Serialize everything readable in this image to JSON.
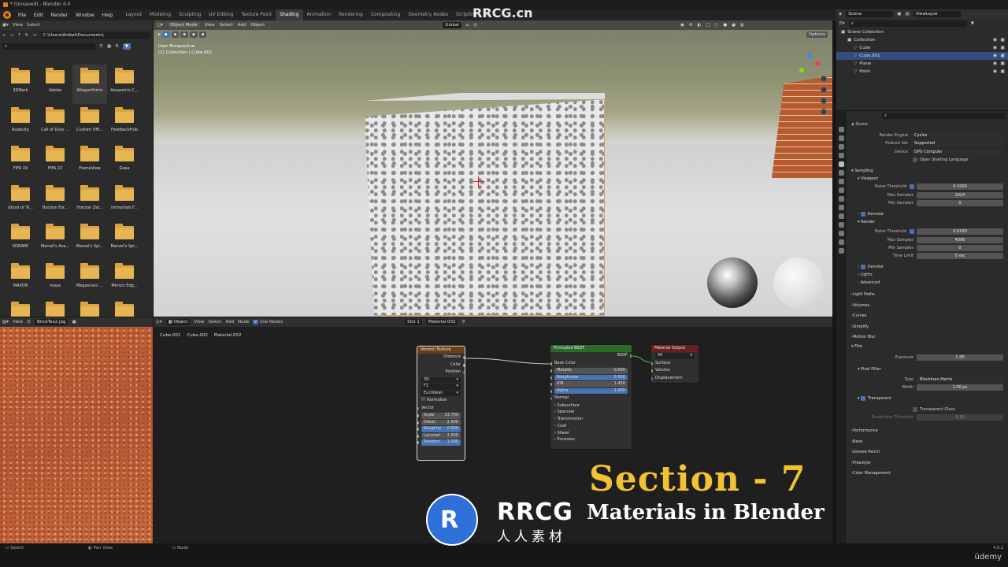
{
  "window": {
    "title": "* (Unsaved) - Blender 4.0"
  },
  "menu": [
    "File",
    "Edit",
    "Render",
    "Window",
    "Help"
  ],
  "workspaces": [
    {
      "label": "Layout",
      "active": false
    },
    {
      "label": "Modeling",
      "active": false
    },
    {
      "label": "Sculpting",
      "active": false
    },
    {
      "label": "UV Editing",
      "active": false
    },
    {
      "label": "Texture Paint",
      "active": false
    },
    {
      "label": "Shading",
      "active": true
    },
    {
      "label": "Animation",
      "active": false
    },
    {
      "label": "Rendering",
      "active": false
    },
    {
      "label": "Compositing",
      "active": false
    },
    {
      "label": "Geometry Nodes",
      "active": false
    },
    {
      "label": "Scripting",
      "active": false
    }
  ],
  "add_workspace": "+",
  "file_browser": {
    "menu": [
      "View",
      "Select"
    ],
    "path": "C:\\Users\\Aniket\\Documents\\",
    "folders": [
      "3DMark",
      "Adobe",
      "Allegorithmic",
      "Assassin's C...",
      "Audacity",
      "Call of Duty ...",
      "Custom Offi...",
      "FeedbackHub",
      "FIFA 19",
      "FIFA 22",
      "FrameView",
      "Gaea",
      "Ghost of Ts...",
      "Horizon For...",
      "Horizon Zer...",
      "Immortals F...",
      "KONAMI",
      "Marvel's Ave...",
      "Marvel's Spi...",
      "Marvel's Spi...",
      "MAXON",
      "maya",
      "Megascans ...",
      "Mirrors Edg...",
      "",
      "",
      "",
      ""
    ],
    "selected_index": 2
  },
  "viewport": {
    "mode": "Object Mode",
    "menu": [
      "View",
      "Select",
      "Add",
      "Object"
    ],
    "orientation": "Global",
    "options": "Options",
    "info_line1": "User Perspective",
    "info_line2": "(1) Collection | Cube.001"
  },
  "image_editor": {
    "view": "View",
    "image_name": "BrickTex2.jpg"
  },
  "node_editor": {
    "mode": "Object",
    "menu": [
      "View",
      "Select",
      "Add",
      "Node"
    ],
    "use_nodes": "Use Nodes",
    "slot": "Slot 1",
    "material": "Material.002",
    "breadcrumb": [
      "Cube.001",
      "Cube.002",
      "Material.002"
    ],
    "voronoi": {
      "title": "Voronoi Texture",
      "outputs": [
        "Distance",
        "Color",
        "Position"
      ],
      "dims": "3D",
      "feature": "F1",
      "metric": "Euclidean",
      "normalize": "Normalize",
      "vector": "Vector",
      "fields": [
        {
          "label": "Scale",
          "value": "13.700"
        },
        {
          "label": "Detail",
          "value": "2.500"
        },
        {
          "label": "Roughne",
          "value": "0.500"
        },
        {
          "label": "Lacunari",
          "value": "2.000"
        },
        {
          "label": "Random",
          "value": "1.000"
        }
      ]
    },
    "bsdf": {
      "title": "Principled BSDF",
      "output": "BSDF",
      "base_color": "Base Color",
      "fields": [
        {
          "label": "Metallic",
          "value": "0.000"
        },
        {
          "label": "Roughness",
          "value": "0.500"
        },
        {
          "label": "IOR",
          "value": "1.450"
        },
        {
          "label": "Alpha",
          "value": "1.000"
        }
      ],
      "normal": "Normal",
      "panels": [
        "Subsurface",
        "Specular",
        "Transmission",
        "Coat",
        "Sheen",
        "Emission"
      ]
    },
    "output": {
      "title": "Material Output",
      "target": "All",
      "inputs": [
        "Surface",
        "Volume",
        "Displacement"
      ]
    }
  },
  "outliner": {
    "scene": "Scene",
    "view_layer": "ViewLayer",
    "items": [
      {
        "label": "Scene Collection",
        "indent": 0,
        "sel": false
      },
      {
        "label": "Collection",
        "indent": 1,
        "sel": false
      },
      {
        "label": "Cube",
        "indent": 2,
        "sel": false
      },
      {
        "label": "Cube.001",
        "indent": 2,
        "sel": true
      },
      {
        "label": "Plane",
        "indent": 2,
        "sel": false
      },
      {
        "label": "Point",
        "indent": 2,
        "sel": false
      }
    ]
  },
  "properties": {
    "context": "Scene",
    "render_engine": {
      "label": "Render Engine",
      "value": "Cycles"
    },
    "feature_set": {
      "label": "Feature Set",
      "value": "Supported"
    },
    "device": {
      "label": "Device",
      "value": "GPU Compute"
    },
    "osl": "Open Shading Language",
    "sampling": "Sampling",
    "viewport": "Viewport",
    "vp_noise": {
      "label": "Noise Threshold",
      "value": "0.1000"
    },
    "vp_max": {
      "label": "Max Samples",
      "value": "1024"
    },
    "vp_min": {
      "label": "Min Samples",
      "value": "0"
    },
    "denoise": "Denoise",
    "render": "Render",
    "r_noise": {
      "label": "Noise Threshold",
      "value": "0.0100"
    },
    "r_max": {
      "label": "Max Samples",
      "value": "4096"
    },
    "r_min": {
      "label": "Min Samples",
      "value": "0"
    },
    "r_time": {
      "label": "Time Limit",
      "value": "0 sec"
    },
    "denoise2": "Denoise",
    "lights": "Lights",
    "advanced": "Advanced",
    "sections1": [
      "Light Paths",
      "Volumes",
      "Curves",
      "Simplify",
      "Motion Blur"
    ],
    "film": "Film",
    "exposure": {
      "label": "Exposure",
      "value": "1.00"
    },
    "pixel_filter": "Pixel Filter",
    "filter_type": {
      "label": "Type",
      "value": "Blackman-Harris"
    },
    "filter_width": {
      "label": "Width",
      "value": "1.50 px"
    },
    "transparent": "Transparent",
    "transparent_glass": "Transparent Glass",
    "roughness_threshold": {
      "label": "Roughness Threshold",
      "value": "0.10"
    },
    "sections2": [
      "Performance",
      "Bake",
      "Grease Pencil",
      "Freestyle",
      "Color Management"
    ]
  },
  "status": {
    "left": "Select",
    "mid": "Pan View",
    "right": "Node",
    "version": "4.0.2",
    "brand": "üdemy"
  },
  "overlay": {
    "title": "Section - 7",
    "subtitle": "Materials in Blender",
    "watermark_big": "RRCG",
    "watermark_cn": "人人素材",
    "watermark_top": "RRCG.cn",
    "title_color": "#f3c232"
  }
}
